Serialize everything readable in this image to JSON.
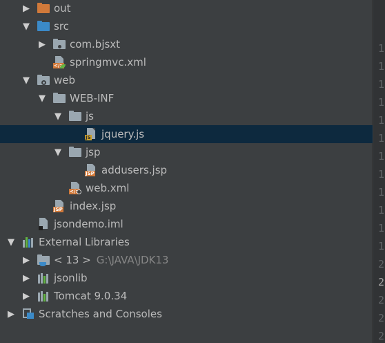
{
  "tree": {
    "out": "out",
    "src": "src",
    "com_bjsxt": "com.bjsxt",
    "springmvc_xml": "springmvc.xml",
    "web": "web",
    "web_inf": "WEB-INF",
    "js": "js",
    "jquery_js": "jquery.js",
    "jsp": "jsp",
    "addusers_jsp": "addusers.jsp",
    "web_xml": "web.xml",
    "index_jsp": "index.jsp",
    "jsondemo_iml": "jsondemo.iml",
    "external_libraries": "External Libraries",
    "jdk13_label": "< 13 >",
    "jdk13_path": "G:\\JAVA\\JDK13",
    "jsonlib": "jsonlib",
    "tomcat": "Tomcat 9.0.34",
    "scratches": "Scratches and Consoles"
  },
  "icons": {
    "file_badges": {
      "js": "JS",
      "jsp": "JSP",
      "xml": "</>"
    }
  },
  "gutter": [
    "1",
    "1",
    "1",
    "1",
    "1",
    "1",
    "1",
    "1",
    "1",
    "1",
    "1",
    "1",
    "2",
    "2",
    "2",
    "2",
    "2",
    "2"
  ],
  "colors": {
    "panel_bg": "#3c3f41",
    "selected_row": "#0d293e",
    "folder_orange": "#d0793a",
    "folder_blue": "#3b8ac8",
    "text": "#bbbbbb",
    "path_text": "#878787"
  }
}
